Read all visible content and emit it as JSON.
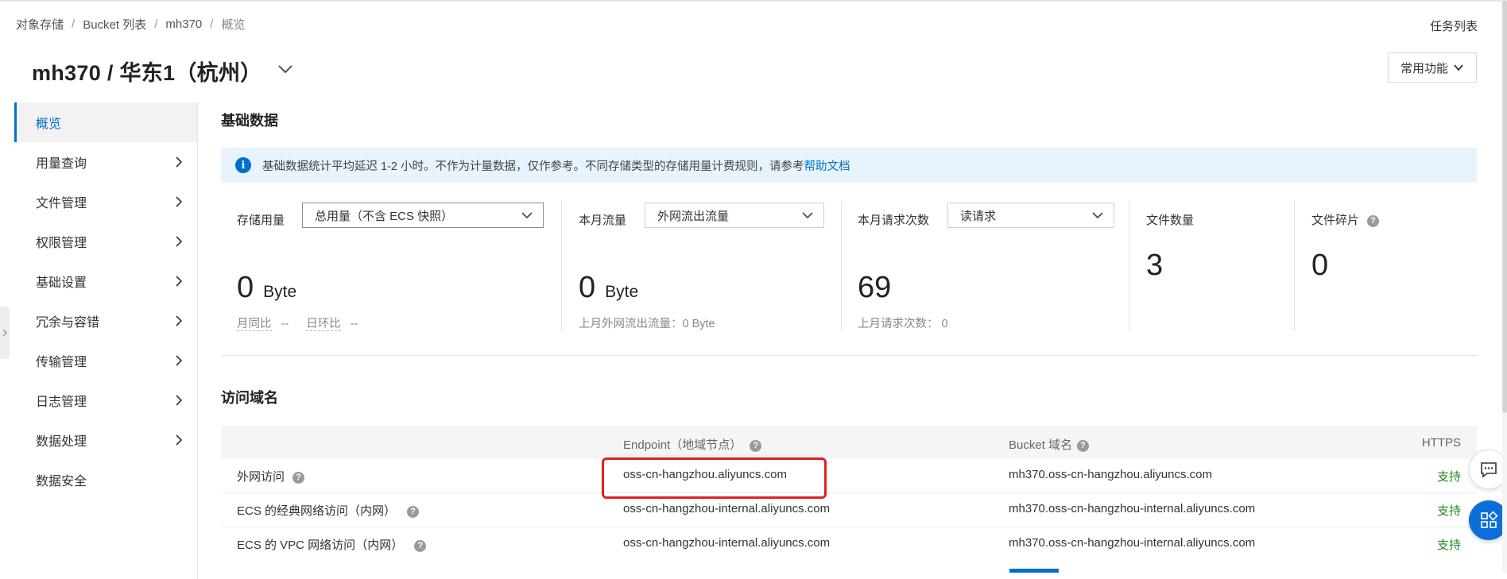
{
  "breadcrumb": {
    "items": [
      "对象存储",
      "Bucket 列表",
      "mh370",
      "概览"
    ],
    "separator": "/"
  },
  "header": {
    "task_list": "任务列表",
    "title": "mh370 / 华东1（杭州）",
    "common_functions": "常用功能"
  },
  "sidebar": {
    "items": [
      {
        "label": "概览",
        "active": true
      },
      {
        "label": "用量查询"
      },
      {
        "label": "文件管理"
      },
      {
        "label": "权限管理"
      },
      {
        "label": "基础设置"
      },
      {
        "label": "冗余与容错"
      },
      {
        "label": "传输管理"
      },
      {
        "label": "日志管理"
      },
      {
        "label": "数据处理"
      },
      {
        "label": "数据安全"
      }
    ]
  },
  "basic": {
    "title": "基础数据",
    "notice": "基础数据统计平均延迟 1-2 小时。不作为计量数据，仅作参考。不同存储类型的存储用量计费规则，请参考",
    "notice_link": "帮助文档",
    "storage": {
      "label": "存储用量",
      "select": "总用量（不含 ECS 快照）",
      "value": "0",
      "unit": "Byte",
      "mom_label": "月同比",
      "mom_value": "--",
      "dod_label": "日环比",
      "dod_value": "--"
    },
    "traffic": {
      "label": "本月流量",
      "select": "外网流出流量",
      "value": "0",
      "unit": "Byte",
      "sub": "上月外网流出流量：0 Byte"
    },
    "requests": {
      "label": "本月请求次数",
      "select": "读请求",
      "value": "69",
      "sub": "上月请求次数：  0"
    },
    "files": {
      "label": "文件数量",
      "value": "3"
    },
    "fragments": {
      "label": "文件碎片",
      "value": "0"
    }
  },
  "domains": {
    "title": "访问域名",
    "headers": {
      "endpoint": "Endpoint（地域节点）",
      "bucket_domain": "Bucket 域名",
      "https": "HTTPS"
    },
    "rows": [
      {
        "type": "外网访问",
        "endpoint": "oss-cn-hangzhou.aliyuncs.com",
        "domain": "mh370.oss-cn-hangzhou.aliyuncs.com",
        "https": "支持"
      },
      {
        "type": "ECS 的经典网络访问（内网）",
        "endpoint": "oss-cn-hangzhou-internal.aliyuncs.com",
        "domain": "mh370.oss-cn-hangzhou-internal.aliyuncs.com",
        "https": "支持"
      },
      {
        "type": "ECS 的 VPC 网络访问（内网）",
        "endpoint": "oss-cn-hangzhou-internal.aliyuncs.com",
        "domain": "mh370.oss-cn-hangzhou-internal.aliyuncs.com",
        "https": "支持"
      }
    ]
  },
  "colors": {
    "accent": "#0070cc",
    "support_green": "#1d8a1d",
    "highlight_red": "#e02020",
    "info_bg": "#e7f3fd"
  },
  "icons": [
    "chevron-down-icon",
    "chevron-right-icon",
    "info-icon",
    "help-icon",
    "chat-icon",
    "apps-icon"
  ]
}
